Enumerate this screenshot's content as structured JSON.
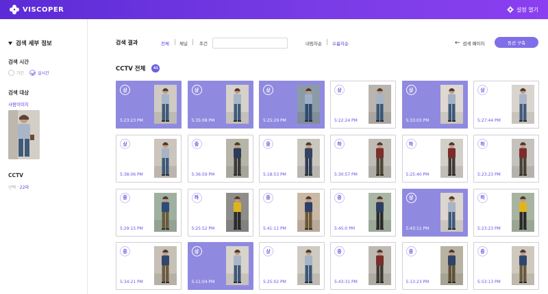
{
  "app": {
    "logo_text": "VISCOPER",
    "settings_label": "설정 열기"
  },
  "sidebar": {
    "title": "검색 세부 정보",
    "time_label": "검색 시간",
    "time_options": [
      "기간",
      "실시간"
    ],
    "target_label": "검색 대상",
    "target_link": "사람이미지",
    "cctv_label": "CCTV",
    "cctv_select_label": "선택 · ",
    "cctv_count": "22대"
  },
  "toolbar": {
    "title": "검색 결과",
    "filters": [
      "전체",
      "채널",
      "조건"
    ],
    "sort": [
      "내림차순",
      "오름차순"
    ],
    "back_label": "검색 페이지",
    "cta_label": "동선 구축"
  },
  "results": {
    "heading": "CCTV 전체",
    "count": "41",
    "cards": [
      {
        "grade": "상",
        "time": "5:23:23 PM",
        "selected": true,
        "top": "#a9b6c8",
        "bottom": "#3f5a7a",
        "bg": "#cfcac3"
      },
      {
        "grade": "상",
        "time": "5:35:08 PM",
        "selected": true,
        "top": "#a8b5c7",
        "bottom": "#405b7c",
        "bg": "#d6d1ca"
      },
      {
        "grade": "상",
        "time": "5:25:29 PM",
        "selected": true,
        "top": "#9fb0c6",
        "bottom": "#2d4b6e",
        "bg": "#8c9aa8"
      },
      {
        "grade": "상",
        "time": "5:22:24 PM",
        "selected": false,
        "top": "#a6b4c6",
        "bottom": "#3a5778",
        "bg": "#b9b4ad"
      },
      {
        "grade": "상",
        "time": "5:33:03 PM",
        "selected": true,
        "top": "#a3b1c4",
        "bottom": "#3c5879",
        "bg": "#ded8d0"
      },
      {
        "grade": "상",
        "time": "5:27:44 PM",
        "selected": false,
        "top": "#aab6c6",
        "bottom": "#425c7c",
        "bg": "#d9d4cd"
      },
      {
        "grade": "상",
        "time": "5:38:06 PM",
        "selected": false,
        "top": "#a7b4c6",
        "bottom": "#3d5979",
        "bg": "#cbc5bd"
      },
      {
        "grade": "중",
        "time": "5:36:59 PM",
        "selected": false,
        "top": "#2c3b57",
        "bottom": "#3a3a3a",
        "bg": "#b6b5a8"
      },
      {
        "grade": "중",
        "time": "5:18:53 PM",
        "selected": false,
        "top": "#34425e",
        "bottom": "#2f3c52",
        "bg": "#c9c6c0"
      },
      {
        "grade": "하",
        "time": "5:30:57 PM",
        "selected": false,
        "top": "#7b2e2a",
        "bottom": "#4e4636",
        "bg": "#bfbcb6"
      },
      {
        "grade": "하",
        "time": "5:25:40 PM",
        "selected": false,
        "top": "#7a2a2a",
        "bottom": "#3f3a34",
        "bg": "#d2cfc9"
      },
      {
        "grade": "하",
        "time": "5:23:23 PM",
        "selected": false,
        "top": "#7d2c2b",
        "bottom": "#4a4236",
        "bg": "#c5c2bd"
      },
      {
        "grade": "중",
        "time": "5:29:15 PM",
        "selected": false,
        "top": "#2f4a75",
        "bottom": "#6b5a3d",
        "bg": "#9fb0a0"
      },
      {
        "grade": "하",
        "time": "5:25:52 PM",
        "selected": false,
        "top": "#e0b21f",
        "bottom": "#2b2b2b",
        "bg": "#8e8d8a"
      },
      {
        "grade": "중",
        "time": "5:41:11 PM",
        "selected": false,
        "top": "#2e3f66",
        "bottom": "#6a5838",
        "bg": "#c8b8a5"
      },
      {
        "grade": "중",
        "time": "5:45:0 PM",
        "selected": false,
        "top": "#2d3d60",
        "bottom": "#2a2a2a",
        "bg": "#a9b6a6"
      },
      {
        "grade": "상",
        "time": "5:43:11 PM",
        "selected": true,
        "top": "#a6b4c6",
        "bottom": "#3f5a7b",
        "bg": "#dcd6ce"
      },
      {
        "grade": "하",
        "time": "5:23:23 PM",
        "selected": false,
        "top": "#e2b41c",
        "bottom": "#2a2a2a",
        "bg": "#a8b4a0"
      },
      {
        "grade": "중",
        "time": "5:34:21 PM",
        "selected": false,
        "top": "#32466c",
        "bottom": "#6b5b3e",
        "bg": "#c6c0b6"
      },
      {
        "grade": "상",
        "time": "5:11:04 PM",
        "selected": true,
        "top": "#a9b6c7",
        "bottom": "#3f5979",
        "bg": "#d8d3cb"
      },
      {
        "grade": "상",
        "time": "5:25:02 PM",
        "selected": false,
        "top": "#a5b3c5",
        "bottom": "#3c5878",
        "bg": "#cfcac2"
      },
      {
        "grade": "중",
        "time": "5:43:31 PM",
        "selected": false,
        "top": "#7b2d2a",
        "bottom": "#3f3a33",
        "bg": "#bdbab4"
      },
      {
        "grade": "중",
        "time": "5:13:23 PM",
        "selected": false,
        "top": "#2f4268",
        "bottom": "#5f5238",
        "bg": "#b7b2a2"
      },
      {
        "grade": "중",
        "time": "5:53:13 PM",
        "selected": false,
        "top": "#30466e",
        "bottom": "#6a5a3d",
        "bg": "#cfc8bc"
      }
    ]
  },
  "colors": {
    "accent": "#5d3de0",
    "selected_card": "#8f8ae0",
    "header_start": "#5b2bd6",
    "header_end": "#8b3ff0"
  },
  "icons": {
    "logo": "viscoper-logo-icon",
    "settings": "gear-icon",
    "back": "arrow-left-icon"
  }
}
